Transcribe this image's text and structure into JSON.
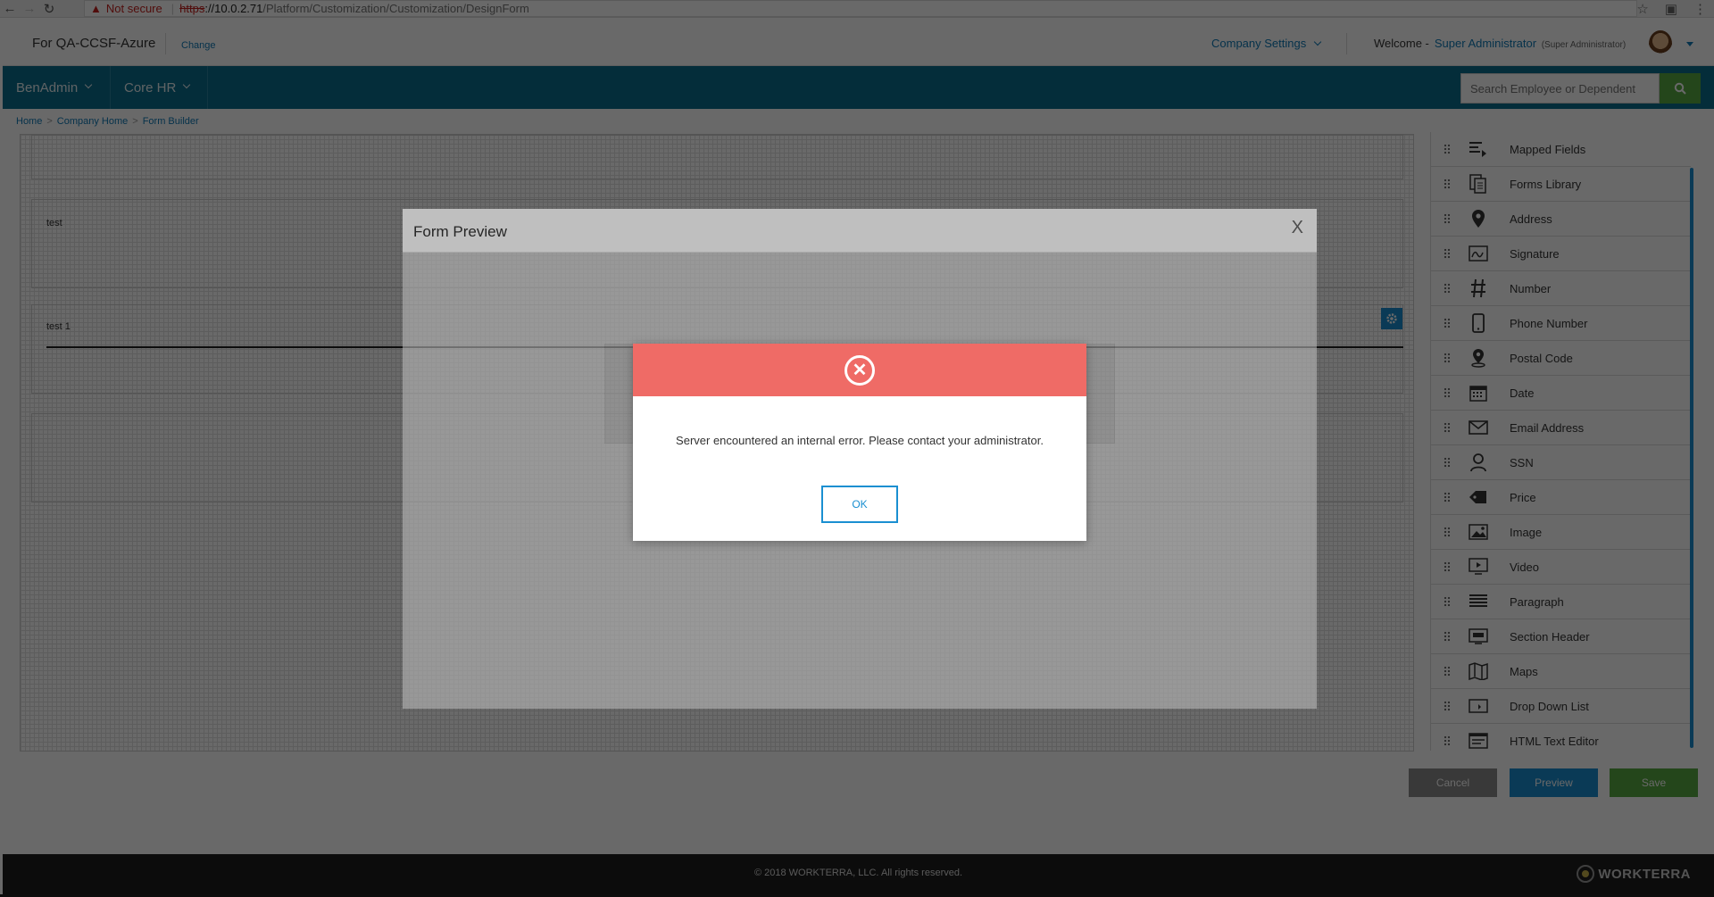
{
  "browser": {
    "not_secure": "Not secure",
    "url_proto": "https",
    "url_host": "://10.0.2.71",
    "url_path": "/Platform/Customization/Customization/DesignForm"
  },
  "header": {
    "company_name": "For QA-CCSF-Azure",
    "change_link": "Change",
    "company_settings": "Company Settings",
    "welcome": "Welcome -",
    "user_name": "Super Administrator",
    "user_role": "(Super Administrator)"
  },
  "nav": {
    "menus": [
      "BenAdmin",
      "Core HR"
    ],
    "search_placeholder": "Search Employee or Dependent"
  },
  "breadcrumb": [
    "Home",
    "Company Home",
    "Form Builder"
  ],
  "canvas": {
    "fields": [
      "test",
      "test 1"
    ]
  },
  "palette": {
    "items": [
      {
        "label": "Mapped Fields",
        "icon": "mapped-fields-icon"
      },
      {
        "label": "Forms Library",
        "icon": "forms-library-icon"
      },
      {
        "label": "Address",
        "icon": "map-pin-icon"
      },
      {
        "label": "Signature",
        "icon": "signature-icon"
      },
      {
        "label": "Number",
        "icon": "hash-icon"
      },
      {
        "label": "Phone Number",
        "icon": "phone-icon"
      },
      {
        "label": "Postal Code",
        "icon": "postal-pin-icon"
      },
      {
        "label": "Date",
        "icon": "calendar-icon"
      },
      {
        "label": "Email Address",
        "icon": "envelope-icon"
      },
      {
        "label": "SSN",
        "icon": "person-icon"
      },
      {
        "label": "Price",
        "icon": "price-tag-icon"
      },
      {
        "label": "Image",
        "icon": "image-icon"
      },
      {
        "label": "Video",
        "icon": "video-icon"
      },
      {
        "label": "Paragraph",
        "icon": "paragraph-icon"
      },
      {
        "label": "Section Header",
        "icon": "section-header-icon"
      },
      {
        "label": "Maps",
        "icon": "map-icon"
      },
      {
        "label": "Drop Down List",
        "icon": "dropdown-icon"
      },
      {
        "label": "HTML Text Editor",
        "icon": "html-editor-icon"
      }
    ]
  },
  "actions": {
    "cancel": "Cancel",
    "preview": "Preview",
    "save": "Save"
  },
  "footer": {
    "copyright": "© 2018 WORKTERRA, LLC. All rights reserved.",
    "brand": "WORKTERRA"
  },
  "preview_modal": {
    "title": "Form Preview",
    "close": "X"
  },
  "error_dialog": {
    "message": "Server encountered an internal error. Please contact your administrator.",
    "ok": "OK"
  },
  "colors": {
    "nav": "#0b6d8e",
    "accent": "#1a8fd1",
    "success": "#5aab44",
    "error": "#ef6b66"
  }
}
